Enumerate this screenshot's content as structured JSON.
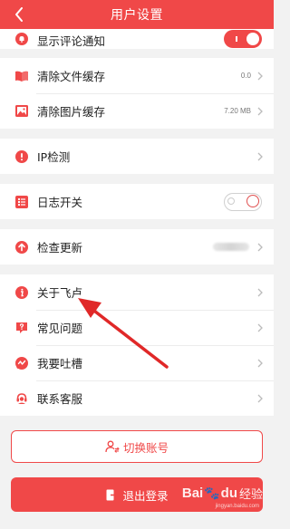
{
  "header": {
    "title": "用户设置"
  },
  "settings": {
    "comment_notify": {
      "label": "显示评论通知",
      "enabled": true
    },
    "clear_file_cache": {
      "label": "清除文件缓存",
      "value": "0.0"
    },
    "clear_image_cache": {
      "label": "清除图片缓存",
      "value": "7.20 MB"
    },
    "ip_check": {
      "label": "IP检测"
    },
    "log_switch": {
      "label": "日志开关",
      "enabled": false
    },
    "check_update": {
      "label": "检查更新"
    },
    "about": {
      "label": "关于飞卢"
    },
    "faq": {
      "label": "常见问题"
    },
    "feedback": {
      "label": "我要吐槽"
    },
    "support": {
      "label": "联系客服"
    }
  },
  "buttons": {
    "switch_account": "切换账号",
    "logout": "退出登录"
  },
  "watermark": {
    "brand_left": "Bai",
    "brand_right": "du",
    "brand_cn": "经验",
    "url": "jingyan.baidu.com"
  },
  "colors": {
    "accent": "#f04848",
    "annotation_arrow": "#e02828"
  }
}
